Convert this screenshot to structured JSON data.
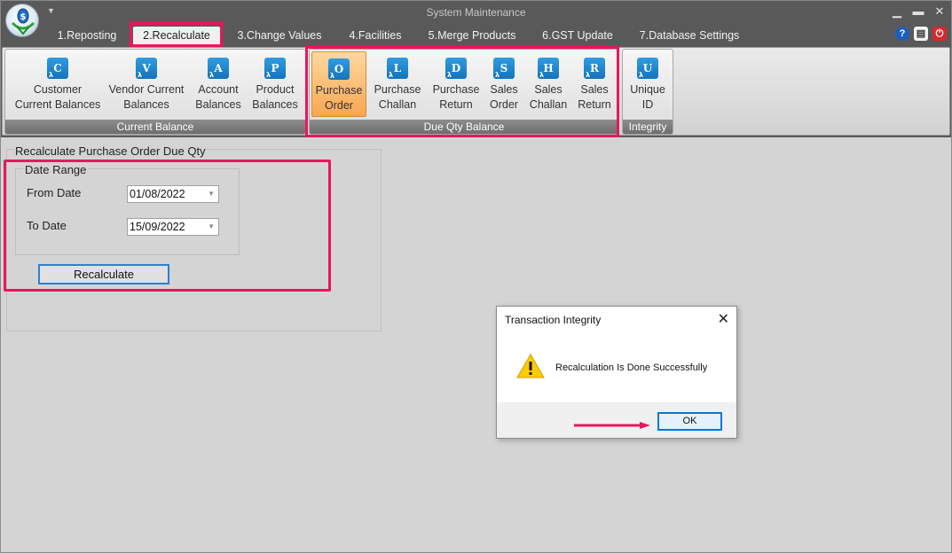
{
  "window": {
    "title": "System Maintenance"
  },
  "tabs": [
    "1.Reposting",
    "2.Recalculate",
    "3.Change Values",
    "4.Facilities",
    "5.Merge Products",
    "6.GST Update",
    "7.Database Settings"
  ],
  "ribbon": {
    "groups": [
      {
        "label": "Current Balance",
        "buttons": [
          {
            "line1": "Customer",
            "line2": "Current Balances",
            "icon_letter": "C"
          },
          {
            "line1": "Vendor Current",
            "line2": "Balances",
            "icon_letter": "V"
          },
          {
            "line1": "Account",
            "line2": "Balances",
            "icon_letter": "A"
          },
          {
            "line1": "Product",
            "line2": "Balances",
            "icon_letter": "P"
          }
        ]
      },
      {
        "label": "Due Qty Balance",
        "buttons": [
          {
            "line1": "Purchase",
            "line2": "Order",
            "icon_letter": "O"
          },
          {
            "line1": "Purchase",
            "line2": "Challan",
            "icon_letter": "L"
          },
          {
            "line1": "Purchase",
            "line2": "Return",
            "icon_letter": "D"
          },
          {
            "line1": "Sales",
            "line2": "Order",
            "icon_letter": "S"
          },
          {
            "line1": "Sales",
            "line2": "Challan",
            "icon_letter": "H"
          },
          {
            "line1": "Sales",
            "line2": "Return",
            "icon_letter": "R"
          }
        ]
      },
      {
        "label": "Integrity",
        "buttons": [
          {
            "line1": "Unique",
            "line2": "ID",
            "icon_letter": "U"
          }
        ]
      }
    ],
    "icon_prefix": "λ"
  },
  "form": {
    "title": "Recalculate Purchase Order Due Qty",
    "date_range_legend": "Date Range",
    "from_label": "From Date",
    "from_value": "01/08/2022",
    "to_label": "To Date",
    "to_value": "15/09/2022",
    "recalc_label": "Recalculate"
  },
  "dialog": {
    "title": "Transaction Integrity",
    "message": "Recalculation Is Done Successfully",
    "ok_label": "OK"
  },
  "colors": {
    "highlight": "#e8175d",
    "active_button": "#f7a752",
    "icon_blue": "#1672b9"
  }
}
